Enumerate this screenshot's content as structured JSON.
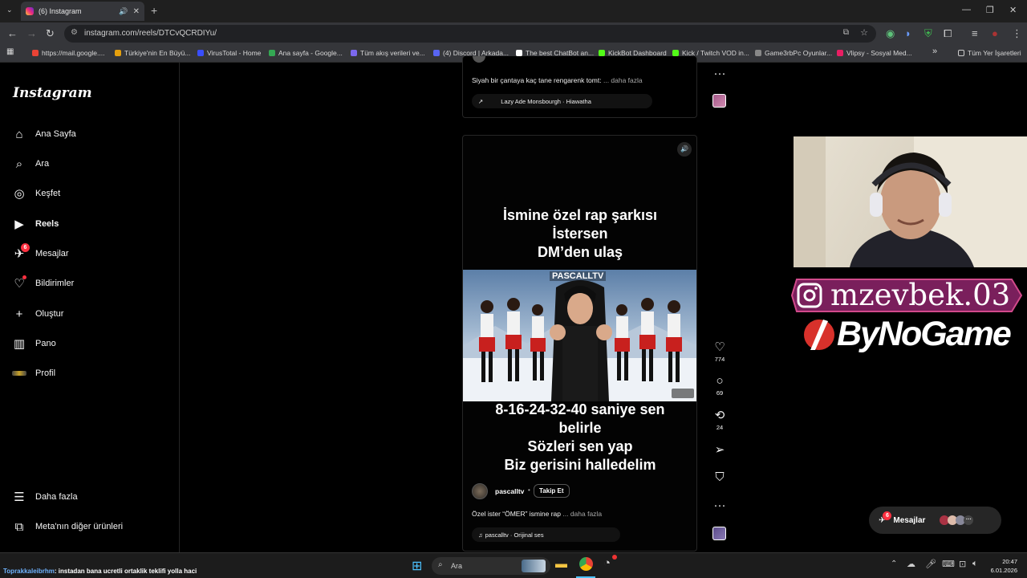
{
  "browser": {
    "tab_title": "(6) Instagram",
    "url": "instagram.com/reels/DTCvQCRDIYu/",
    "bookmarks": [
      "https://mail.google....",
      "Türkiye'nin En Büyü...",
      "VirusTotal - Home",
      "Ana sayfa - Google...",
      "Tüm akış verileri ve...",
      "(4) Discord | Arkada...",
      "The best ChatBot an...",
      "KickBot Dashboard",
      "Kick / Twitch VOD in...",
      "Game3rbPc Oyunlar...",
      "Vlipsy - Sosyal Med...",
      "Tüm Yer İşaretleri"
    ]
  },
  "sidebar": {
    "logo": "Instagram",
    "items": [
      {
        "label": "Ana Sayfa",
        "icon": "home-icon"
      },
      {
        "label": "Ara",
        "icon": "search-icon"
      },
      {
        "label": "Keşfet",
        "icon": "compass-icon"
      },
      {
        "label": "Reels",
        "icon": "reels-icon"
      },
      {
        "label": "Mesajlar",
        "icon": "messenger-icon",
        "badge": "6"
      },
      {
        "label": "Bildirimler",
        "icon": "heart-icon"
      },
      {
        "label": "Oluştur",
        "icon": "plus-icon"
      },
      {
        "label": "Pano",
        "icon": "dashboard-icon"
      },
      {
        "label": "Profil",
        "icon": "avatar"
      }
    ],
    "more": "Daha fazla",
    "meta": "Meta'nın diğer ürünleri"
  },
  "prev_reel": {
    "caption": "Siyah bir çantaya kaç tane rengarenk tomt:",
    "more": "... daha fazla",
    "audio": "Lazy Ade Monsbourgh · Hiawatha"
  },
  "reel": {
    "top_text": [
      "İsmine özel rap şarkısı",
      "İstersen",
      "DM’den ulaş"
    ],
    "watermark": "PASCALLTV",
    "bottom_text": [
      "8-16-24-32-40 saniye sen",
      "belirle",
      "Sözleri sen yap",
      "Biz gerisini halledelim"
    ],
    "username": "pascalltv",
    "follow": "Takip Et",
    "caption": "Özel ister “ÖMER” ismine rap",
    "more": "... daha fazla",
    "audio": "pascalltv · Orijinal ses",
    "likes": "774",
    "comments": "69",
    "reposts": "24"
  },
  "overlay": {
    "instagram_handle": "mzevbek.03",
    "brand": "ByNoGame"
  },
  "messages_pill": {
    "label": "Mesajlar",
    "badge": "6"
  },
  "taskbar": {
    "chat_user": "Toprakkaleibrhm",
    "chat_text": ": instadan bana ucretli ortaklik teklifi yolla haci",
    "search": "Ara",
    "time": "20:47",
    "date": "6.01.2026"
  }
}
